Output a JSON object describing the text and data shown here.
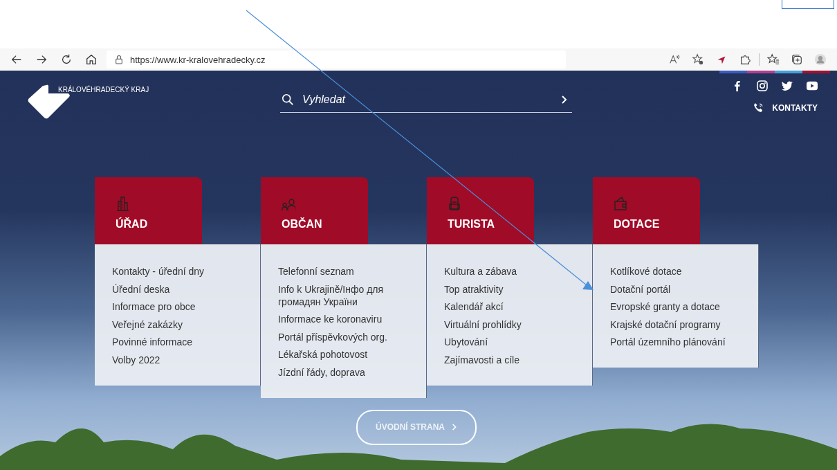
{
  "browser": {
    "url": "https://www.kr-kralovehradecky.cz"
  },
  "header": {
    "logo_text": "KRÁLOVÉHRADECKÝ KRAJ",
    "search": {
      "placeholder": "Vyhledat"
    },
    "contacts": "KONTAKTY"
  },
  "sections": [
    {
      "title": "ÚŘAD",
      "kind": "building",
      "links": [
        "Kontakty - úřední dny",
        "Úřední deska",
        "Informace pro obce",
        "Veřejné zakázky",
        "Povinné informace",
        "Volby 2022"
      ]
    },
    {
      "title": "OBČAN",
      "kind": "people",
      "links": [
        "Telefonní seznam",
        "Info k Ukrajině/Інфо для громадян України",
        "Informace ke koronaviru",
        "Portál příspěvkových org.",
        "Lékařská pohotovost",
        "Jízdní řády, doprava"
      ]
    },
    {
      "title": "TURISTA",
      "kind": "backpack",
      "links": [
        "Kultura a zábava",
        "Top atraktivity",
        "Kalendář akcí",
        "Virtuální prohlídky",
        "Ubytování",
        "Zajímavosti a cíle"
      ]
    },
    {
      "title": "DOTACE",
      "kind": "wallet",
      "links": [
        "Kotlíkové dotace",
        "Dotační portál",
        "Evropské granty a dotace",
        "Krajské dotační programy",
        "Portál územního plánování"
      ]
    }
  ],
  "home_button": "ÚVODNÍ STRANA"
}
